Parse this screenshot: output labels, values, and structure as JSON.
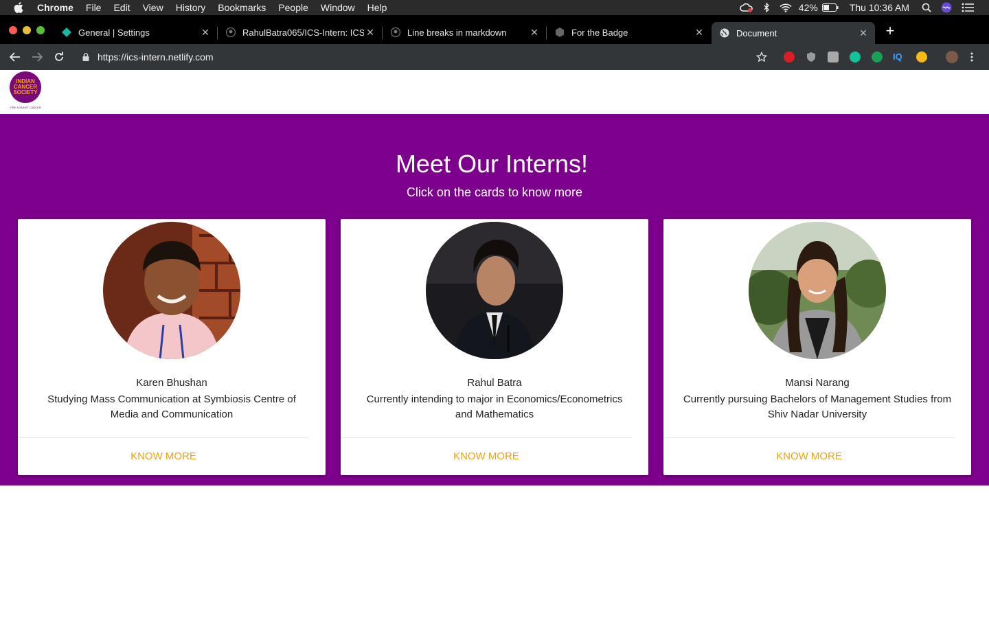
{
  "menubar": {
    "app_name": "Chrome",
    "menus": [
      "File",
      "Edit",
      "View",
      "History",
      "Bookmarks",
      "People",
      "Window",
      "Help"
    ],
    "battery": "42%",
    "clock": "Thu 10:36 AM"
  },
  "browser": {
    "tabs": [
      {
        "title": "General | Settings"
      },
      {
        "title": "RahulBatra065/ICS-Intern: ICS"
      },
      {
        "title": "Line breaks in markdown"
      },
      {
        "title": "For the Badge"
      },
      {
        "title": "Document"
      }
    ],
    "url": "https://ics-intern.netlify.com"
  },
  "site": {
    "logo_text": [
      "INDIAN",
      "CANCER",
      "SOCIETY"
    ],
    "logo_tagline": "FIRE AGAINST CANCER"
  },
  "hero": {
    "title": "Meet Our Interns!",
    "subtitle": "Click on the cards to know more",
    "background": "#7d008c"
  },
  "interns": [
    {
      "name": "Karen Bhushan",
      "bio": "Studying Mass Communication at Symbiosis Centre of Media and Communication",
      "cta": "Know More"
    },
    {
      "name": "Rahul Batra",
      "bio": "Currently intending to major in Economics/Econometrics and Mathematics",
      "cta": "Know More"
    },
    {
      "name": "Mansi Narang",
      "bio": "Currently pursuing Bachelors of Management Studies from Shiv Nadar University",
      "cta": "Know More"
    }
  ],
  "colors": {
    "accent": "#f2a20c",
    "brand_purple": "#7d008c"
  }
}
